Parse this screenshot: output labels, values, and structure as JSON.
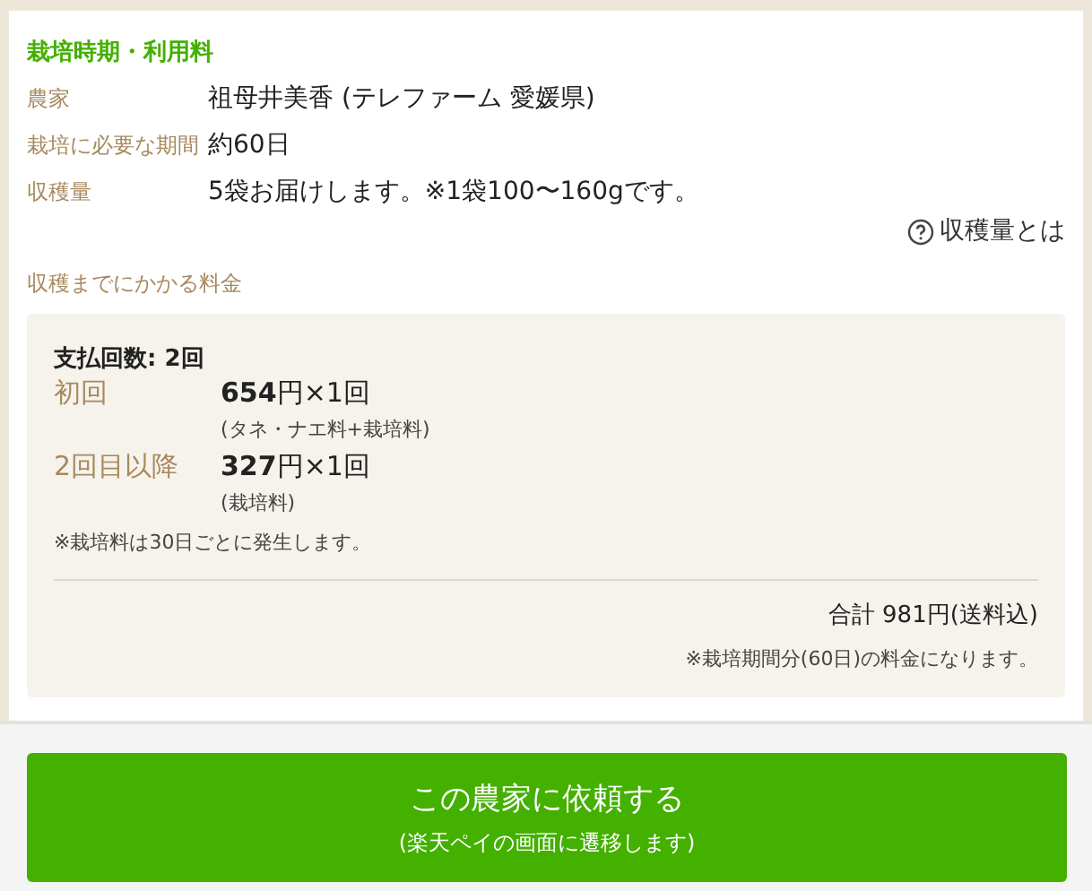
{
  "section_title": "栽培時期・利用料",
  "details": [
    {
      "label": "農家",
      "value": "祖母井美香 (テレファーム 愛媛県)"
    },
    {
      "label": "栽培に必要な期間",
      "value": "約60日"
    },
    {
      "label": "収穫量",
      "value": "5袋お届けします。※1袋100〜160gです。"
    }
  ],
  "help_link": "収穫量とは",
  "fees_label": "収穫までにかかる料金",
  "fees": {
    "count": "支払回数: 2回",
    "rows": [
      {
        "label": "初回",
        "price": "**654**円×1回",
        "note": "(タネ・ナエ料+栽培料)"
      },
      {
        "label": "2回目以降",
        "price": "**327**円×1回",
        "note": "(栽培料)"
      }
    ],
    "footnote": "※栽培料は30日ごとに発生します。",
    "total": "合計 981円(送料込)",
    "total_note": "※栽培期間分(60日)の料金になります。"
  },
  "button": {
    "label": "この農家に依頼する",
    "sublabel": "(楽天ペイの画面に遷移します)"
  }
}
